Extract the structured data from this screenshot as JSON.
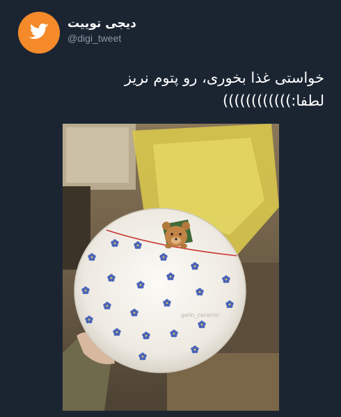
{
  "account": {
    "display_name": "دیجی توییت",
    "handle": "@digi_tweet",
    "avatar_icon": "twitter-bird-icon",
    "avatar_color": "#f48a2a"
  },
  "tweet": {
    "line1": "خواستی غذا بخوری، رو پتوم نریز",
    "line2": "لطفا:))))))))))))"
  },
  "media": {
    "watermark": "gelin_ceramic"
  },
  "colors": {
    "background": "#1b2532",
    "text": "#ffffff",
    "muted": "#8b98a5"
  }
}
